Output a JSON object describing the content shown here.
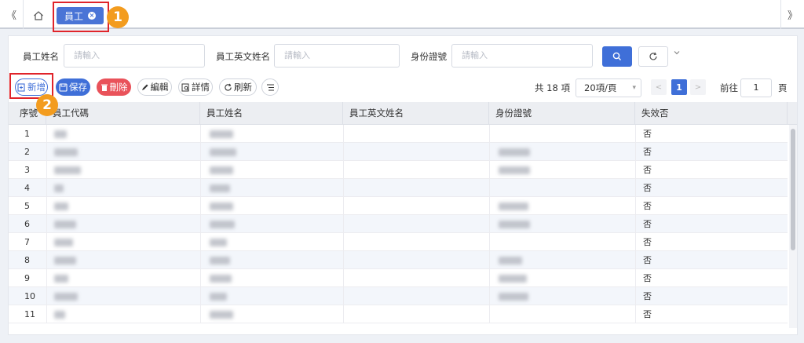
{
  "tabbar": {
    "active_tab": "員工",
    "close_glyph": "×",
    "left_arrow": "《",
    "right_arrow": "》"
  },
  "callouts": [
    "1",
    "2"
  ],
  "search": {
    "name_label": "員工姓名",
    "name_placeholder": "請輸入",
    "en_name_label": "員工英文姓名",
    "en_name_placeholder": "請輸入",
    "id_label": "身份證號",
    "id_placeholder": "請輸入"
  },
  "toolbar": {
    "add": "新增",
    "save": "保存",
    "delete": "刪除",
    "edit": "編輯",
    "detail": "詳情",
    "refresh": "刷新"
  },
  "pager": {
    "total": "共 18 項",
    "page_size": "20項/頁",
    "current_page": "1",
    "goto_label": "前往",
    "goto_value": "1",
    "unit": "頁"
  },
  "table": {
    "columns": [
      "序號",
      "員工代碼",
      "員工姓名",
      "員工英文姓名",
      "身份證號",
      "失效否"
    ],
    "rows": [
      {
        "no": "1",
        "invalid": "否"
      },
      {
        "no": "2",
        "invalid": "否"
      },
      {
        "no": "3",
        "invalid": "否"
      },
      {
        "no": "4",
        "invalid": "否"
      },
      {
        "no": "5",
        "invalid": "否"
      },
      {
        "no": "6",
        "invalid": "否"
      },
      {
        "no": "7",
        "invalid": "否"
      },
      {
        "no": "8",
        "invalid": "否"
      },
      {
        "no": "9",
        "invalid": "否"
      },
      {
        "no": "10",
        "invalid": "否"
      },
      {
        "no": "11",
        "invalid": "否"
      }
    ]
  },
  "colors": {
    "primary": "#3f6fd8",
    "danger": "#e9525a",
    "callout": "#e0242a",
    "badge": "#f39c1f"
  }
}
